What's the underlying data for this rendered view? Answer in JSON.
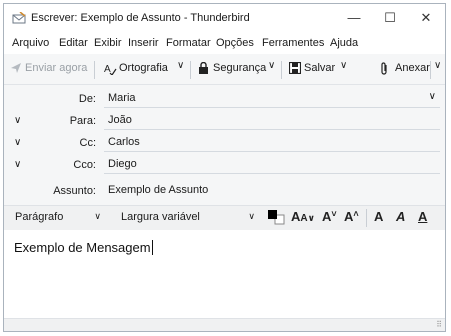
{
  "window": {
    "title": "Escrever: Exemplo de Assunto - Thunderbird",
    "minimize": "—",
    "maximize": "☐",
    "close": "✕"
  },
  "menu": [
    "Arquivo",
    "Editar",
    "Exibir",
    "Inserir",
    "Formatar",
    "Opções",
    "Ferramentes",
    "Ajuda"
  ],
  "toolbar": {
    "send_later": "Enviar agora",
    "spelling": "Ortografia",
    "security": "Segurança",
    "save": "Salvar",
    "attach": "Anexar"
  },
  "headers": {
    "from_label": "De:",
    "from_value": "Maria",
    "to_label": "Para:",
    "to_value": "João",
    "cc_label": "Cc:",
    "cc_value": "Carlos",
    "bcc_label": "Cco:",
    "bcc_value": "Diego",
    "subject_label": "Assunto:",
    "subject_value": "Exemplo de Assunto"
  },
  "format": {
    "paragraph": "Parágrafo",
    "font": "Largura variável"
  },
  "body": {
    "text": "Exemplo de Mensagem"
  },
  "colors": {
    "toolbar_bg": "#f5f6f7",
    "disabled": "#9aa0a6"
  }
}
